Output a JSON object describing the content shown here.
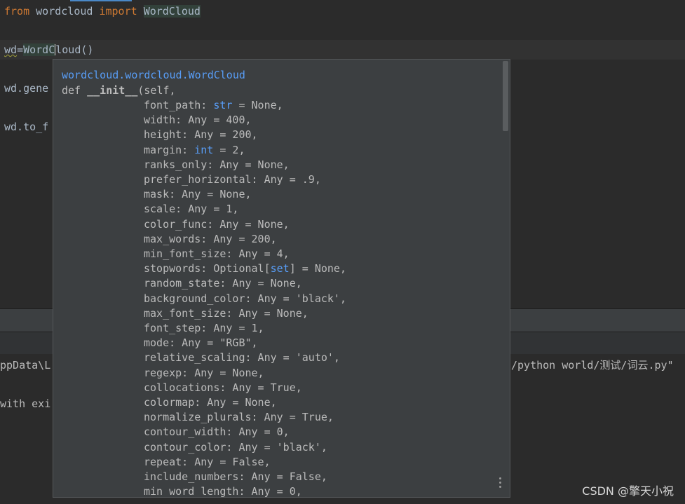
{
  "editor": {
    "line1": {
      "kw_from": "from",
      "module": " wordcloud ",
      "kw_import": "import",
      "space": " ",
      "cls": "WordCloud"
    },
    "line2": {
      "pre": "wd",
      "eq": "=",
      "call_a": "WordC",
      "call_b": "loud()"
    },
    "line3_partial": "wd.gene",
    "line4_partial": "wd.to_f"
  },
  "run_panel": {
    "cmd_left": "ppData\\L",
    "cmd_right": "/python world/测试/词云.py\"",
    "exit_partial": "with exi"
  },
  "popup": {
    "qualified_name": "wordcloud.wordcloud.WordCloud",
    "def_kw": "def ",
    "init_name": "__init__",
    "self_part": "(self,",
    "params": [
      {
        "name": "font_path: ",
        "type": "str",
        "rest": " = None,"
      },
      {
        "name": "width: Any = 400,",
        "type": "",
        "rest": ""
      },
      {
        "name": "height: Any = 200,",
        "type": "",
        "rest": ""
      },
      {
        "name": "margin: ",
        "type": "int",
        "rest": " = 2,"
      },
      {
        "name": "ranks_only: Any = None,",
        "type": "",
        "rest": ""
      },
      {
        "name": "prefer_horizontal: Any = .9,",
        "type": "",
        "rest": ""
      },
      {
        "name": "mask: Any = None,",
        "type": "",
        "rest": ""
      },
      {
        "name": "scale: Any = 1,",
        "type": "",
        "rest": ""
      },
      {
        "name": "color_func: Any = None,",
        "type": "",
        "rest": ""
      },
      {
        "name": "max_words: Any = 200,",
        "type": "",
        "rest": ""
      },
      {
        "name": "min_font_size: Any = 4,",
        "type": "",
        "rest": ""
      },
      {
        "name": "stopwords: Optional[",
        "type": "set",
        "rest": "] = None,"
      },
      {
        "name": "random_state: Any = None,",
        "type": "",
        "rest": ""
      },
      {
        "name": "background_color: Any = 'black',",
        "type": "",
        "rest": ""
      },
      {
        "name": "max_font_size: Any = None,",
        "type": "",
        "rest": ""
      },
      {
        "name": "font_step: Any = 1,",
        "type": "",
        "rest": ""
      },
      {
        "name": "mode: Any = \"RGB\",",
        "type": "",
        "rest": ""
      },
      {
        "name": "relative_scaling: Any = 'auto',",
        "type": "",
        "rest": ""
      },
      {
        "name": "regexp: Any = None,",
        "type": "",
        "rest": ""
      },
      {
        "name": "collocations: Any = True,",
        "type": "",
        "rest": ""
      },
      {
        "name": "colormap: Any = None,",
        "type": "",
        "rest": ""
      },
      {
        "name": "normalize_plurals: Any = True,",
        "type": "",
        "rest": ""
      },
      {
        "name": "contour_width: Any = 0,",
        "type": "",
        "rest": ""
      },
      {
        "name": "contour_color: Any = 'black',",
        "type": "",
        "rest": ""
      },
      {
        "name": "repeat: Any = False,",
        "type": "",
        "rest": ""
      },
      {
        "name": "include_numbers: Any = False,",
        "type": "",
        "rest": ""
      },
      {
        "name": "min_word_length: Any = 0,",
        "type": "",
        "rest": ""
      }
    ],
    "more_icon": "more-vertical-icon"
  },
  "watermark": "CSDN @擎天小祝"
}
